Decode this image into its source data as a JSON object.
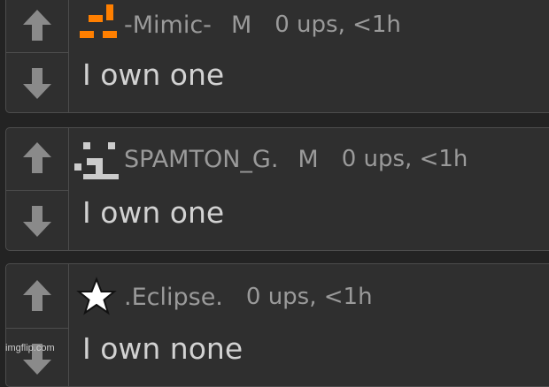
{
  "comments": [
    {
      "avatar": "pixel-face-orange-icon",
      "username": "-Mimic-",
      "gender": "M",
      "meta": "0 ups, <1h",
      "text": "I own one",
      "upvote_icon": "arrow-up-icon",
      "downvote_icon": "arrow-down-icon"
    },
    {
      "avatar": "pixel-face-gray-icon",
      "username": "SPAMTON_G.",
      "gender": "M",
      "meta": "0 ups, <1h",
      "text": "I own one",
      "upvote_icon": "arrow-up-icon",
      "downvote_icon": "arrow-down-icon"
    },
    {
      "avatar": "star-icon",
      "username": ".Eclipse.",
      "meta": "0 ups, <1h",
      "text": "I own none",
      "upvote_icon": "arrow-up-icon",
      "downvote_icon": "arrow-down-icon"
    }
  ],
  "watermark": "imgflip.com",
  "colors": {
    "background": "#232323",
    "card": "#2f2f2f",
    "border": "#4c4c4c",
    "arrow": "#8a8a8a",
    "meta_text": "#9a9a9a",
    "body_text": "#d2d2d2",
    "orange_avatar": "#ff7f00",
    "gray_avatar": "#cccccc"
  }
}
